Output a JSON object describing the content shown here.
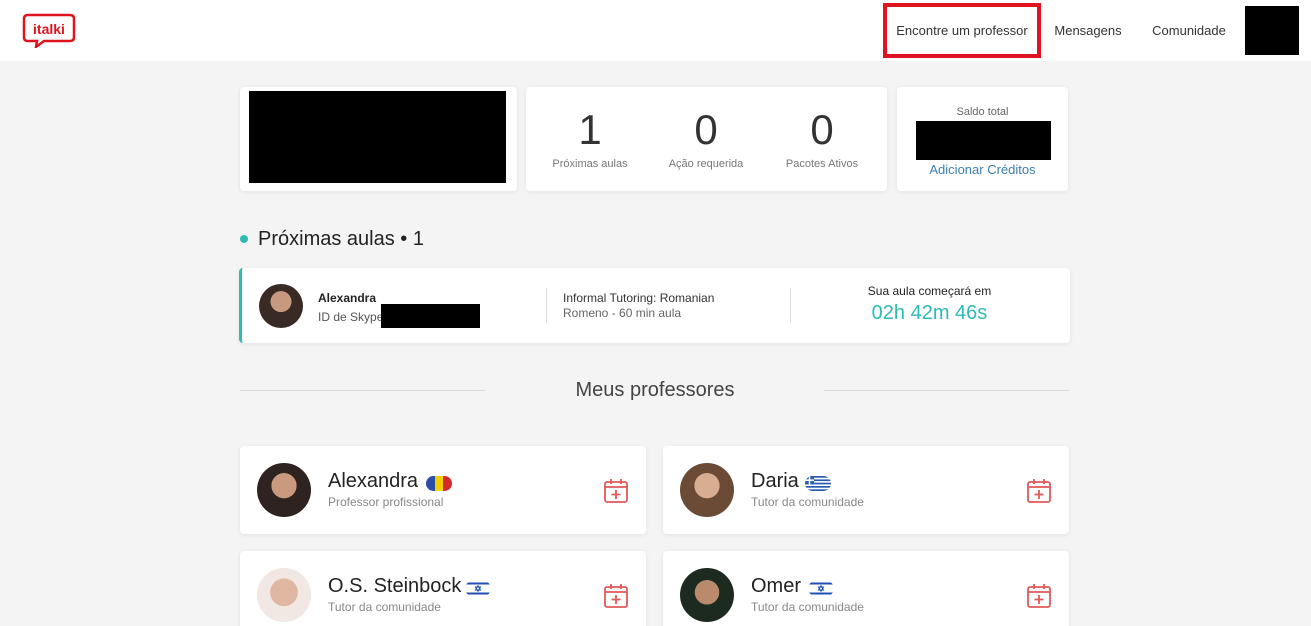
{
  "header": {
    "logo_text": "italki",
    "nav": {
      "find_teacher": "Encontre um professor",
      "messages": "Mensagens",
      "community": "Comunidade"
    }
  },
  "stats": [
    {
      "value": "1",
      "label": "Próximas aulas"
    },
    {
      "value": "0",
      "label": "Ação requerida"
    },
    {
      "value": "0",
      "label": "Pacotes Ativos"
    }
  ],
  "balance": {
    "label": "Saldo total",
    "add_credits": "Adicionar Créditos"
  },
  "upcoming": {
    "title": "Próximas aulas • 1",
    "lesson": {
      "teacher": "Alexandra",
      "skype_label": "ID de Skype",
      "course": "Informal Tutoring: Romanian",
      "detail": "Romeno - 60 min aula",
      "start_label": "Sua aula começará em",
      "countdown": "02h 42m 46s"
    }
  },
  "my_teachers": {
    "title": "Meus professores",
    "teachers": [
      {
        "name": "Alexandra",
        "role": "Professor profissional",
        "flag": "romania"
      },
      {
        "name": "Daria",
        "role": "Tutor da comunidade",
        "flag": "greece"
      },
      {
        "name": "O.S. Steinbock",
        "role": "Tutor da comunidade",
        "flag": "israel"
      },
      {
        "name": "Omer",
        "role": "Tutor da comunidade",
        "flag": "israel"
      }
    ]
  },
  "colors": {
    "accent": "#2cbcb4",
    "brand_red": "#e0141f",
    "link": "#3b7fb0",
    "calendar_icon": "#e05a5a"
  }
}
